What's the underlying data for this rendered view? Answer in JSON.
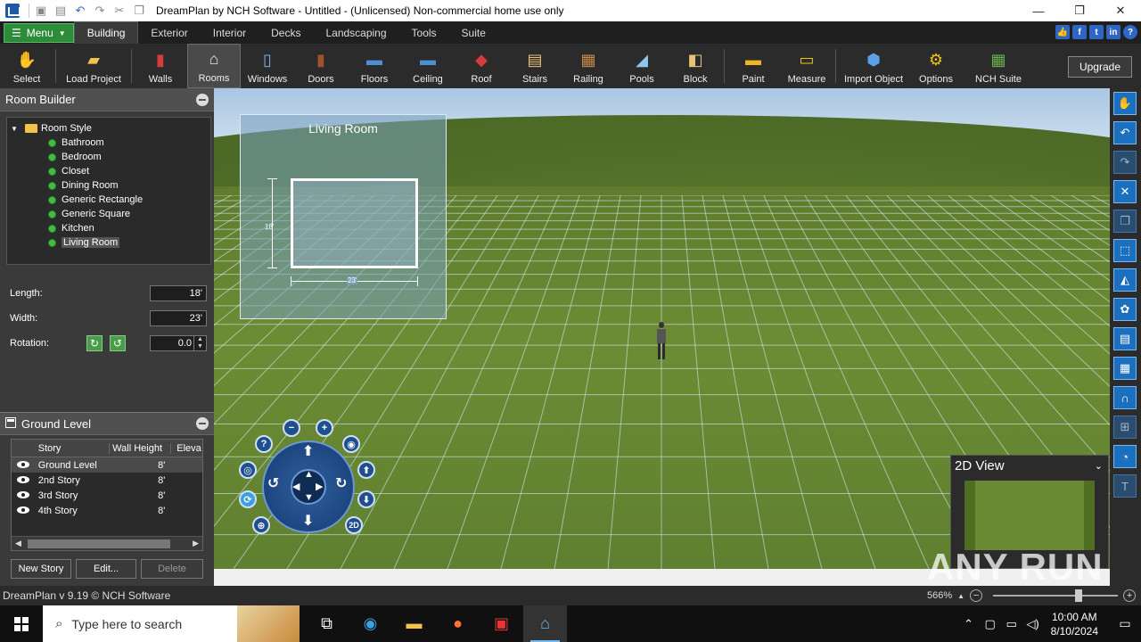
{
  "window": {
    "title": "DreamPlan by NCH Software - Untitled - (Unlicensed) Non-commercial home use only",
    "controls": [
      "minimize",
      "restore",
      "close"
    ]
  },
  "quick_access": [
    "print-icon",
    "save-icon",
    "undo-icon",
    "redo-icon",
    "cut-icon",
    "copy-icon"
  ],
  "ribbon": {
    "menu_label": "Menu",
    "tabs": [
      "Building",
      "Exterior",
      "Interior",
      "Decks",
      "Landscaping",
      "Tools",
      "Suite"
    ],
    "active_tab": "Building"
  },
  "toolbar": {
    "tools": [
      {
        "label": "Select",
        "icon": "hand-cursor-icon"
      },
      {
        "label": "Load Project",
        "icon": "folder-icon"
      },
      {
        "label": "Walls",
        "icon": "walls-icon"
      },
      {
        "label": "Rooms",
        "icon": "rooms-icon"
      },
      {
        "label": "Windows",
        "icon": "window-icon"
      },
      {
        "label": "Doors",
        "icon": "door-icon"
      },
      {
        "label": "Floors",
        "icon": "floors-icon"
      },
      {
        "label": "Ceiling",
        "icon": "ceiling-icon"
      },
      {
        "label": "Roof",
        "icon": "roof-icon"
      },
      {
        "label": "Stairs",
        "icon": "stairs-icon"
      },
      {
        "label": "Railing",
        "icon": "railing-icon"
      },
      {
        "label": "Pools",
        "icon": "pool-icon"
      },
      {
        "label": "Block",
        "icon": "block-icon"
      },
      {
        "label": "Paint",
        "icon": "paint-roller-icon"
      },
      {
        "label": "Measure",
        "icon": "ruler-icon"
      },
      {
        "label": "Import Object",
        "icon": "import-cube-icon"
      },
      {
        "label": "Options",
        "icon": "options-icon"
      },
      {
        "label": "NCH Suite",
        "icon": "suite-icon"
      }
    ],
    "active_tool": "Rooms",
    "upgrade_label": "Upgrade"
  },
  "room_builder": {
    "title": "Room Builder",
    "tree_root": "Room Style",
    "room_styles": [
      "Bathroom",
      "Bedroom",
      "Closet",
      "Dining Room",
      "Generic Rectangle",
      "Generic Square",
      "Kitchen",
      "Living Room"
    ],
    "selected_style": "Living Room",
    "length_label": "Length:",
    "length_value": "18'",
    "width_label": "Width:",
    "width_value": "23'",
    "rotation_label": "Rotation:",
    "rotation_value": "0.0"
  },
  "preview": {
    "title": "Living Room",
    "height_label": "18'",
    "width_label": "23'"
  },
  "ground_level": {
    "title": "Ground Level",
    "columns": [
      "Story",
      "Wall Height",
      "Eleva"
    ],
    "stories": [
      {
        "name": "Ground Level",
        "wall_height": "8'"
      },
      {
        "name": "2nd Story",
        "wall_height": "8'"
      },
      {
        "name": "3rd Story",
        "wall_height": "8'"
      },
      {
        "name": "4th Story",
        "wall_height": "8'"
      }
    ],
    "buttons": {
      "new": "New Story",
      "edit": "Edit...",
      "delete": "Delete"
    }
  },
  "nav_control": {
    "help": "?",
    "zoom_out": "−",
    "zoom_in": "+",
    "camera": "camera-icon",
    "mode_2d": "2D"
  },
  "view2d": {
    "title": "2D View"
  },
  "status": {
    "text": "DreamPlan v 9.19 © NCH Software",
    "zoom": "566%"
  },
  "watermark": "ANY RUN",
  "taskbar": {
    "search_placeholder": "Type here to search",
    "time": "10:00 AM",
    "date": "8/10/2024"
  }
}
